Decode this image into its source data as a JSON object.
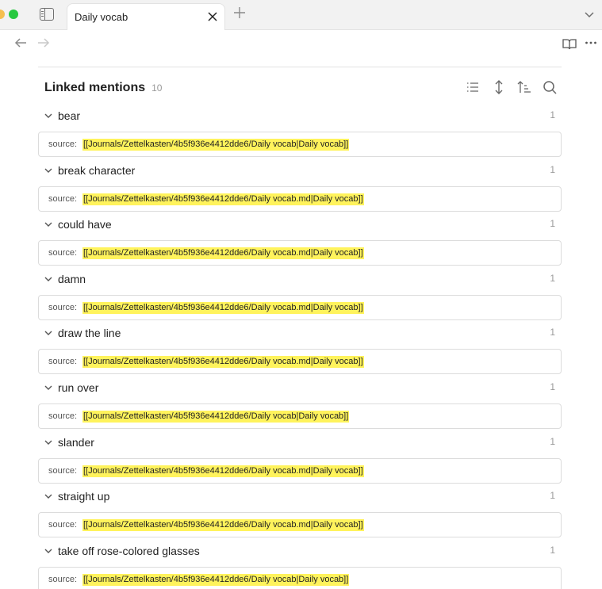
{
  "tab": {
    "title": "Daily vocab"
  },
  "linked_mentions": {
    "title": "Linked mentions",
    "count": "10",
    "source_prefix": "source:",
    "entries": [
      {
        "term": "bear",
        "count": "1",
        "link": "[[Journals/Zettelkasten/4b5f936e4412dde6/Daily vocab|Daily vocab]]"
      },
      {
        "term": "break character",
        "count": "1",
        "link": "[[Journals/Zettelkasten/4b5f936e4412dde6/Daily vocab.md|Daily vocab]]"
      },
      {
        "term": "could have",
        "count": "1",
        "link": "[[Journals/Zettelkasten/4b5f936e4412dde6/Daily vocab.md|Daily vocab]]"
      },
      {
        "term": "damn",
        "count": "1",
        "link": "[[Journals/Zettelkasten/4b5f936e4412dde6/Daily vocab.md|Daily vocab]]"
      },
      {
        "term": "draw the line",
        "count": "1",
        "link": "[[Journals/Zettelkasten/4b5f936e4412dde6/Daily vocab.md|Daily vocab]]"
      },
      {
        "term": "run over",
        "count": "1",
        "link": "[[Journals/Zettelkasten/4b5f936e4412dde6/Daily vocab|Daily vocab]]"
      },
      {
        "term": "slander",
        "count": "1",
        "link": "[[Journals/Zettelkasten/4b5f936e4412dde6/Daily vocab.md|Daily vocab]]"
      },
      {
        "term": "straight up",
        "count": "1",
        "link": "[[Journals/Zettelkasten/4b5f936e4412dde6/Daily vocab.md|Daily vocab]]"
      },
      {
        "term": "take off rose-colored glasses",
        "count": "1",
        "link": "[[Journals/Zettelkasten/4b5f936e4412dde6/Daily vocab|Daily vocab]]"
      }
    ]
  },
  "colors": {
    "highlight": "#fff35c",
    "traffic_yellow": "#f5bf4f",
    "traffic_green": "#28c840"
  },
  "icons": [
    "sidebar-toggle-icon",
    "close-icon",
    "plus-icon",
    "chevron-down-icon",
    "arrow-left-icon",
    "arrow-right-icon",
    "book-open-icon",
    "more-icon",
    "list-icon",
    "expand-vertical-icon",
    "sort-icon",
    "search-icon"
  ]
}
